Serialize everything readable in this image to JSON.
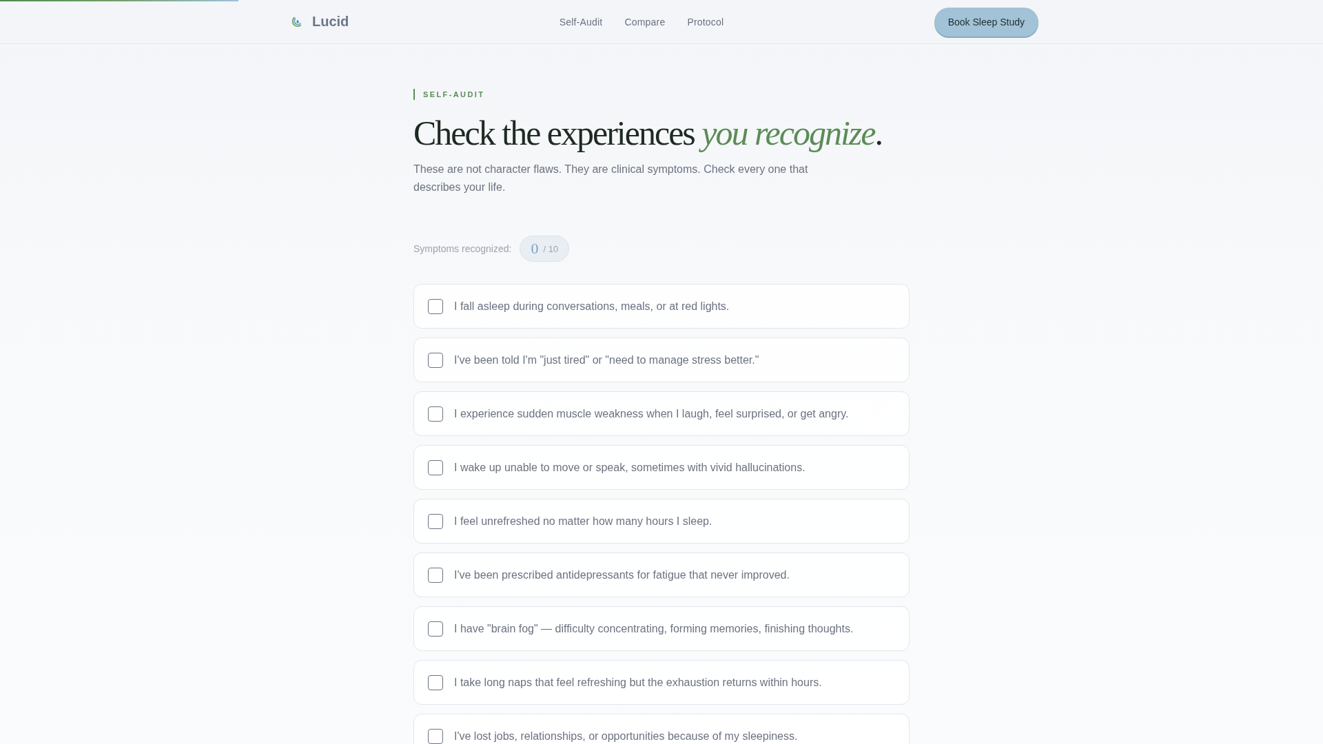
{
  "scroll_progress": {
    "level": 0.18
  },
  "header": {
    "brand": "Lucid",
    "nav": [
      "Self-Audit",
      "Compare",
      "Protocol"
    ],
    "cta": "Book Sleep Study"
  },
  "intro": {
    "eyebrow": "SELF-AUDIT",
    "heading": "Check the experiences *you recognize*.",
    "description": "These are not character flaws. They are clinical symptoms. Check every one that describes your life."
  },
  "counter": {
    "label": "Symptoms recognized:",
    "count": "0",
    "total": "/ 10"
  },
  "items": [
    {
      "text": "I fall asleep during conversations, meals, or at red lights.",
      "checked": false
    },
    {
      "text": "I've been told I'm \"just tired\" or \"need to manage stress better.\"",
      "checked": false
    },
    {
      "text": "I experience sudden muscle weakness when I laugh, feel surprised, or get angry.",
      "checked": false
    },
    {
      "text": "I wake up unable to move or speak, sometimes with vivid hallucinations.",
      "checked": false
    },
    {
      "text": "I feel unrefreshed no matter how many hours I sleep.",
      "checked": false
    },
    {
      "text": "I've been prescribed antidepressants for fatigue that never improved.",
      "checked": false
    },
    {
      "text": "I have \"brain fog\" — difficulty concentrating, forming memories, finishing thoughts.",
      "checked": false
    },
    {
      "text": "I take long naps that feel refreshing but the exhaustion returns within hours.",
      "checked": false
    },
    {
      "text": "I've lost jobs, relationships, or opportunities because of my sleepiness.",
      "checked": false
    }
  ]
}
